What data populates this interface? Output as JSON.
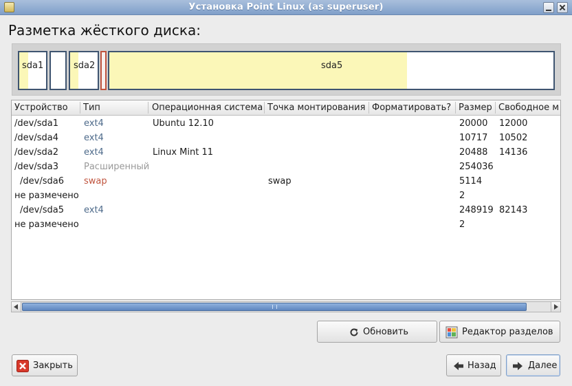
{
  "window": {
    "title": "Установка Point Linux (as superuser)",
    "icons": {
      "app": "app-icon",
      "minimize": "minimize-icon",
      "close": "close-icon"
    }
  },
  "page": {
    "heading": "Разметка жёсткого диска:"
  },
  "partition_bar": {
    "segments": [
      {
        "label": "sda1",
        "used_fraction": 0.33
      },
      {
        "label": "",
        "used_fraction": 0.0
      },
      {
        "label": "sda2",
        "used_fraction": 0.31
      },
      {
        "label": "",
        "used_fraction": 0.0
      },
      {
        "label": "sda5",
        "used_fraction": 0.67
      }
    ]
  },
  "table": {
    "columns": [
      "Устройство",
      "Тип",
      "Операционная система",
      "Точка монтирования",
      "Форматировать?",
      "Размер",
      "Свободное м"
    ],
    "rows": [
      {
        "device": "/dev/sda1",
        "type": "ext4",
        "os": "Ubuntu 12.10",
        "mount": "",
        "size": "20000",
        "free": "12000"
      },
      {
        "device": "/dev/sda4",
        "type": "ext4",
        "os": "",
        "mount": "",
        "size": "10717",
        "free": "10502"
      },
      {
        "device": "/dev/sda2",
        "type": "ext4",
        "os": "Linux Mint 11",
        "mount": "",
        "size": "20488",
        "free": "14136"
      },
      {
        "device": "/dev/sda3",
        "type": "Расширенный",
        "os": "",
        "mount": "",
        "size": "254036",
        "free": ""
      },
      {
        "device": "/dev/sda6",
        "type": "swap",
        "os": "",
        "mount": "swap",
        "size": "5114",
        "free": ""
      },
      {
        "device": "не размечено",
        "type": "",
        "os": "",
        "mount": "",
        "size": "2",
        "free": ""
      },
      {
        "device": "/dev/sda5",
        "type": "ext4",
        "os": "",
        "mount": "",
        "size": "248919",
        "free": "82143"
      },
      {
        "device": "не размечено",
        "type": "",
        "os": "",
        "mount": "",
        "size": "2",
        "free": ""
      }
    ]
  },
  "colors": {
    "ext4": "#4d6a8a",
    "extended": "#999999",
    "swap": "#c0543e",
    "partition_fill": "#fbf7b8",
    "partition_border": "#3e5470"
  },
  "buttons": {
    "refresh": {
      "label": "Обновить",
      "icon": "refresh-icon"
    },
    "partition_editor": {
      "label": "Редактор разделов",
      "icon": "partition-editor-icon"
    },
    "close": {
      "label": "Закрыть",
      "icon": "close-x-icon"
    },
    "back": {
      "label": "Назад",
      "icon": "arrow-left-icon"
    },
    "next": {
      "label": "Далее",
      "icon": "arrow-right-icon"
    }
  }
}
